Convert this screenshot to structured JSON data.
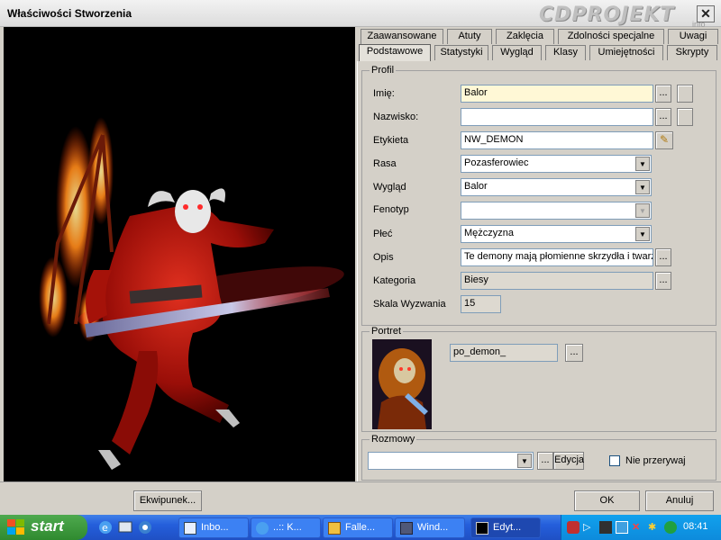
{
  "window": {
    "title": "Właściwości Stworzenia",
    "watermark": "CDPROJEKT",
    "watermark_sub": "info",
    "close": "✕"
  },
  "tabs_row1": [
    "Zaawansowane",
    "Atuty",
    "Zaklęcia",
    "Zdolności specjalne",
    "Uwagi"
  ],
  "tabs_row2": [
    "Podstawowe",
    "Statystyki",
    "Wygląd",
    "Klasy",
    "Umiejętności",
    "Skrypty"
  ],
  "profile": {
    "group_label": "Profil",
    "name_label": "Imię:",
    "name_value": "Balor",
    "surname_label": "Nazwisko:",
    "surname_value": "",
    "tag_label": "Etykieta",
    "tag_value": "NW_DEMON",
    "race_label": "Rasa",
    "race_value": "Pozasferowiec",
    "appearance_label": "Wygląd",
    "appearance_value": "Balor",
    "phenotype_label": "Fenotyp",
    "phenotype_value": "",
    "gender_label": "Płeć",
    "gender_value": "Mężczyzna",
    "desc_label": "Opis",
    "desc_value": "Te demony mają płomienne skrzydła i twarz",
    "category_label": "Kategoria",
    "category_value": "Biesy",
    "cr_label": "Skala Wyzwania",
    "cr_value": "15",
    "ellipsis": "..."
  },
  "portrait": {
    "group_label": "Portret",
    "value": "po_demon_",
    "ellipsis": "..."
  },
  "conversation": {
    "group_label": "Rozmowy",
    "value": "",
    "ellipsis": "...",
    "edit_label": "Edycja",
    "no_interrupt_label": "Nie przerywaj"
  },
  "bottom": {
    "inventory_label": "Ekwipunek...",
    "ok_label": "OK",
    "cancel_label": "Anuluj"
  },
  "taskbar": {
    "start_label": "start",
    "tasks": [
      "Inbo...",
      "..:: K...",
      "Falle...",
      "Wind...",
      "Edyt..."
    ],
    "clock": "08:41"
  },
  "colors": {
    "taskbar_blue": "#245edb",
    "start_green": "#2f8a2f",
    "tray_blue": "#0d8bdc",
    "highlight_field": "#fff8d6"
  }
}
